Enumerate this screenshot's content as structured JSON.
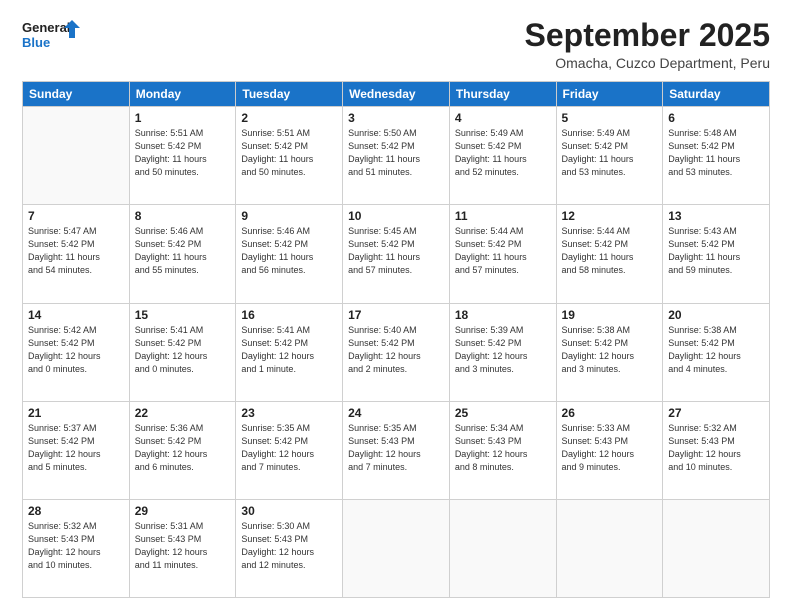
{
  "header": {
    "logo_line1": "General",
    "logo_line2": "Blue",
    "month": "September 2025",
    "location": "Omacha, Cuzco Department, Peru"
  },
  "days_of_week": [
    "Sunday",
    "Monday",
    "Tuesday",
    "Wednesday",
    "Thursday",
    "Friday",
    "Saturday"
  ],
  "weeks": [
    [
      {
        "day": "",
        "info": ""
      },
      {
        "day": "1",
        "info": "Sunrise: 5:51 AM\nSunset: 5:42 PM\nDaylight: 11 hours\nand 50 minutes."
      },
      {
        "day": "2",
        "info": "Sunrise: 5:51 AM\nSunset: 5:42 PM\nDaylight: 11 hours\nand 50 minutes."
      },
      {
        "day": "3",
        "info": "Sunrise: 5:50 AM\nSunset: 5:42 PM\nDaylight: 11 hours\nand 51 minutes."
      },
      {
        "day": "4",
        "info": "Sunrise: 5:49 AM\nSunset: 5:42 PM\nDaylight: 11 hours\nand 52 minutes."
      },
      {
        "day": "5",
        "info": "Sunrise: 5:49 AM\nSunset: 5:42 PM\nDaylight: 11 hours\nand 53 minutes."
      },
      {
        "day": "6",
        "info": "Sunrise: 5:48 AM\nSunset: 5:42 PM\nDaylight: 11 hours\nand 53 minutes."
      }
    ],
    [
      {
        "day": "7",
        "info": "Sunrise: 5:47 AM\nSunset: 5:42 PM\nDaylight: 11 hours\nand 54 minutes."
      },
      {
        "day": "8",
        "info": "Sunrise: 5:46 AM\nSunset: 5:42 PM\nDaylight: 11 hours\nand 55 minutes."
      },
      {
        "day": "9",
        "info": "Sunrise: 5:46 AM\nSunset: 5:42 PM\nDaylight: 11 hours\nand 56 minutes."
      },
      {
        "day": "10",
        "info": "Sunrise: 5:45 AM\nSunset: 5:42 PM\nDaylight: 11 hours\nand 57 minutes."
      },
      {
        "day": "11",
        "info": "Sunrise: 5:44 AM\nSunset: 5:42 PM\nDaylight: 11 hours\nand 57 minutes."
      },
      {
        "day": "12",
        "info": "Sunrise: 5:44 AM\nSunset: 5:42 PM\nDaylight: 11 hours\nand 58 minutes."
      },
      {
        "day": "13",
        "info": "Sunrise: 5:43 AM\nSunset: 5:42 PM\nDaylight: 11 hours\nand 59 minutes."
      }
    ],
    [
      {
        "day": "14",
        "info": "Sunrise: 5:42 AM\nSunset: 5:42 PM\nDaylight: 12 hours\nand 0 minutes."
      },
      {
        "day": "15",
        "info": "Sunrise: 5:41 AM\nSunset: 5:42 PM\nDaylight: 12 hours\nand 0 minutes."
      },
      {
        "day": "16",
        "info": "Sunrise: 5:41 AM\nSunset: 5:42 PM\nDaylight: 12 hours\nand 1 minute."
      },
      {
        "day": "17",
        "info": "Sunrise: 5:40 AM\nSunset: 5:42 PM\nDaylight: 12 hours\nand 2 minutes."
      },
      {
        "day": "18",
        "info": "Sunrise: 5:39 AM\nSunset: 5:42 PM\nDaylight: 12 hours\nand 3 minutes."
      },
      {
        "day": "19",
        "info": "Sunrise: 5:38 AM\nSunset: 5:42 PM\nDaylight: 12 hours\nand 3 minutes."
      },
      {
        "day": "20",
        "info": "Sunrise: 5:38 AM\nSunset: 5:42 PM\nDaylight: 12 hours\nand 4 minutes."
      }
    ],
    [
      {
        "day": "21",
        "info": "Sunrise: 5:37 AM\nSunset: 5:42 PM\nDaylight: 12 hours\nand 5 minutes."
      },
      {
        "day": "22",
        "info": "Sunrise: 5:36 AM\nSunset: 5:42 PM\nDaylight: 12 hours\nand 6 minutes."
      },
      {
        "day": "23",
        "info": "Sunrise: 5:35 AM\nSunset: 5:42 PM\nDaylight: 12 hours\nand 7 minutes."
      },
      {
        "day": "24",
        "info": "Sunrise: 5:35 AM\nSunset: 5:43 PM\nDaylight: 12 hours\nand 7 minutes."
      },
      {
        "day": "25",
        "info": "Sunrise: 5:34 AM\nSunset: 5:43 PM\nDaylight: 12 hours\nand 8 minutes."
      },
      {
        "day": "26",
        "info": "Sunrise: 5:33 AM\nSunset: 5:43 PM\nDaylight: 12 hours\nand 9 minutes."
      },
      {
        "day": "27",
        "info": "Sunrise: 5:32 AM\nSunset: 5:43 PM\nDaylight: 12 hours\nand 10 minutes."
      }
    ],
    [
      {
        "day": "28",
        "info": "Sunrise: 5:32 AM\nSunset: 5:43 PM\nDaylight: 12 hours\nand 10 minutes."
      },
      {
        "day": "29",
        "info": "Sunrise: 5:31 AM\nSunset: 5:43 PM\nDaylight: 12 hours\nand 11 minutes."
      },
      {
        "day": "30",
        "info": "Sunrise: 5:30 AM\nSunset: 5:43 PM\nDaylight: 12 hours\nand 12 minutes."
      },
      {
        "day": "",
        "info": ""
      },
      {
        "day": "",
        "info": ""
      },
      {
        "day": "",
        "info": ""
      },
      {
        "day": "",
        "info": ""
      }
    ]
  ]
}
